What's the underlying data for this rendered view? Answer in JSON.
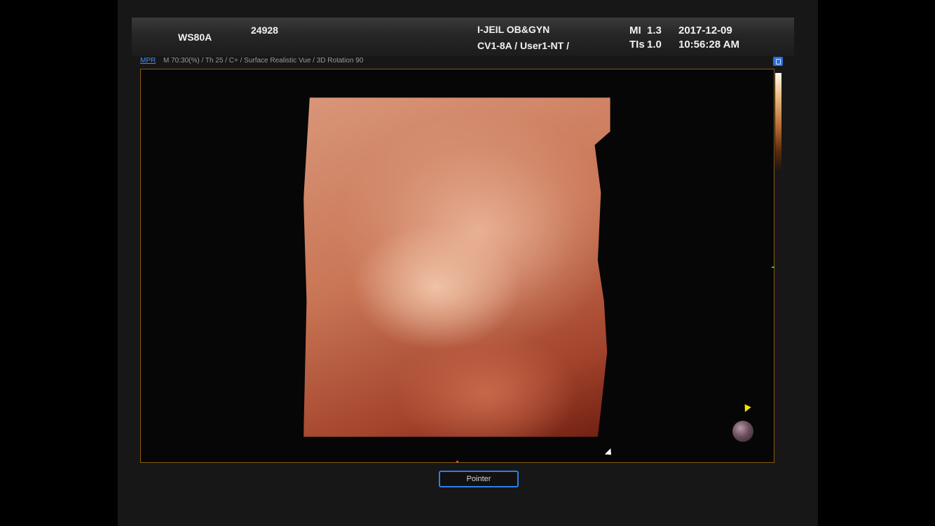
{
  "header": {
    "model": "WS80A",
    "id": "24928",
    "hospital": "I-JEIL OB&GYN",
    "probe_user": "CV1-8A / User1-NT /",
    "mi_label": "MI",
    "mi_value": "1.3",
    "tis_label": "TIs",
    "tis_value": "1.0",
    "date": "2017-12-09",
    "time": "10:56:28 AM"
  },
  "status": {
    "mode_link": "MPR",
    "params": "M 70:30(%) / Th 25 / C+ / Surface Realistic Vue / 3D Rotation 90"
  },
  "buttons": {
    "pointer": "Pointer"
  },
  "colors": {
    "accent": "#2d7df0",
    "viewport_border": "#8a5a12",
    "render_tone": "#d99679"
  },
  "icons": {
    "pin": "pin-icon",
    "orientation": "orientation-ball-icon",
    "cursor": "cursor-icon"
  }
}
